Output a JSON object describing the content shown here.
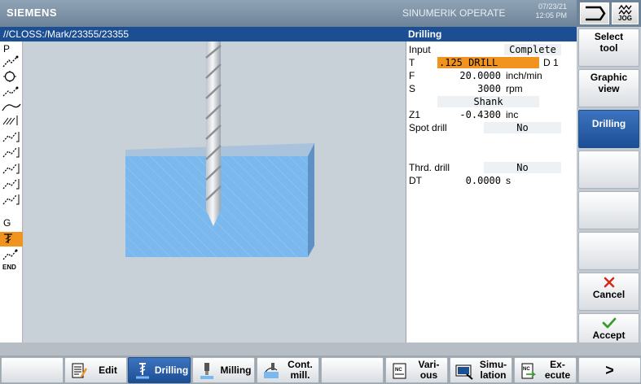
{
  "header": {
    "brand": "SIEMENS",
    "product": "SINUMERIK OPERATE",
    "date": "07/23/21",
    "time": "12:05 PM",
    "mode_label": "JOG"
  },
  "path": "//CLOSS:/Mark/23355/23355",
  "form": {
    "title": "Drilling",
    "rows": [
      {
        "label": "Input",
        "value": "Complete"
      },
      {
        "label": "T",
        "value": ".125 DRILL",
        "extra": "D 1"
      },
      {
        "label": "F",
        "value": "20.0000",
        "unit": "inch/min"
      },
      {
        "label": "S",
        "value": "3000",
        "unit": "rpm"
      },
      {
        "label": "",
        "value": "Shank"
      },
      {
        "label": "Z1",
        "value": "-0.4300",
        "unit": "inc"
      },
      {
        "label": "Spot drill",
        "value": "No"
      },
      {
        "label": "Thrd. drill",
        "value": "No"
      },
      {
        "label": "DT",
        "value": "0.0000",
        "unit": "s"
      }
    ]
  },
  "left_strip": {
    "p_letter": "P",
    "g_letter": "G",
    "end_label": "END"
  },
  "vertical_softkeys": [
    {
      "label_1": "Select",
      "label_2": "tool"
    },
    {
      "label_1": "Graphic",
      "label_2": "view"
    },
    {
      "label_1": "Drilling",
      "label_2": ""
    },
    {
      "label_1": "",
      "label_2": ""
    },
    {
      "label_1": "",
      "label_2": ""
    },
    {
      "label_1": "",
      "label_2": ""
    },
    {
      "label_1": "Cancel",
      "label_2": ""
    },
    {
      "label_1": "Accept",
      "label_2": ""
    }
  ],
  "horizontal_softkeys": [
    {
      "label": ""
    },
    {
      "label": "Edit"
    },
    {
      "label": "Drilling"
    },
    {
      "label": "Milling"
    },
    {
      "label": "Cont. mill."
    },
    {
      "label": ""
    },
    {
      "label": "Vari- ous"
    },
    {
      "label": "Simu- lation"
    },
    {
      "label": "Ex- ecute"
    },
    {
      "label": ">"
    }
  ],
  "colors": {
    "title_bar": "#1c4e94",
    "selection": "#f0931f",
    "workpiece": "#7ab8ee",
    "cancel": "#d42a1a",
    "accept": "#3a9b2c"
  }
}
